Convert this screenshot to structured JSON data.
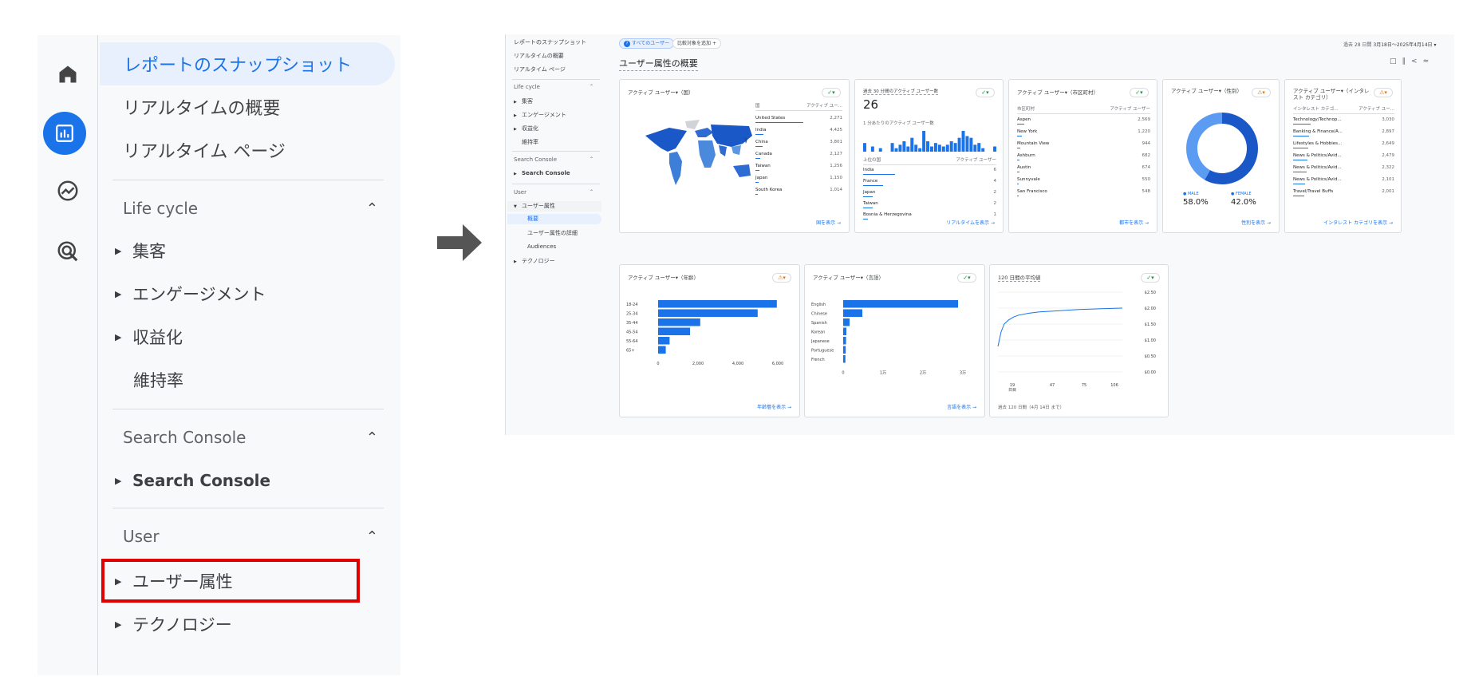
{
  "left_nav": {
    "items": {
      "snapshot": "レポートのスナップショット",
      "realtime_overview": "リアルタイムの概要",
      "realtime_pages": "リアルタイム ページ"
    },
    "sections": {
      "lifecycle": {
        "title": "Life cycle",
        "items": [
          "集客",
          "エンゲージメント",
          "収益化",
          "維持率"
        ]
      },
      "search_console": {
        "title": "Search Console",
        "items": [
          "Search Console"
        ]
      },
      "user": {
        "title": "User",
        "items": [
          "ユーザー属性",
          "テクノロジー"
        ]
      }
    }
  },
  "screenshot": {
    "nav": {
      "items": [
        "レポートのスナップショット",
        "リアルタイムの概要",
        "リアルタイム ページ"
      ],
      "lifecycle_title": "Life cycle",
      "lifecycle_items": [
        "集客",
        "エンゲージメント",
        "収益化",
        "維持率"
      ],
      "sc_title": "Search Console",
      "sc_item": "Search Console",
      "user_title": "User",
      "user_items": [
        "ユーザー属性",
        "概要",
        "ユーザー属性の詳細",
        "Audiences",
        "テクノロジー"
      ]
    },
    "header": {
      "chip_all_users": "すべてのユーザー",
      "chip_compare": "比較対象を追加",
      "page_title": "ユーザー属性の概要",
      "date_prefix": "過去 28 日間",
      "date_range": "3月18日～2025年4月14日"
    },
    "cards": {
      "country": {
        "title": "アクティブ ユーザー▾（国）",
        "col1": "国",
        "col2": "アクティブ ユー...",
        "rows": [
          {
            "name": "United States",
            "value": "2,271"
          },
          {
            "name": "India",
            "value": "4,425"
          },
          {
            "name": "China",
            "value": "3,801"
          },
          {
            "name": "Canada",
            "value": "2,127"
          },
          {
            "name": "Taiwan",
            "value": "1,256"
          },
          {
            "name": "Japan",
            "value": "1,150"
          },
          {
            "name": "South Korea",
            "value": "1,014"
          }
        ],
        "link": "国を表示 →"
      },
      "realtime": {
        "title": "過去 30 分間のアクティブ ユーザー数",
        "value": "26",
        "subtitle": "1 分あたりのアクティブ ユーザー数",
        "col1": "上位の国",
        "col2": "アクティブ ユーザー",
        "rows": [
          {
            "name": "India",
            "value": "6"
          },
          {
            "name": "France",
            "value": "4"
          },
          {
            "name": "Japan",
            "value": "2"
          },
          {
            "name": "Taiwan",
            "value": "2"
          },
          {
            "name": "Bosnia & Herzegovina",
            "value": "1"
          }
        ],
        "link": "リアルタイムを表示 →"
      },
      "city": {
        "title": "アクティブ ユーザー▾（市区町村）",
        "col1": "市区町村",
        "col2": "アクティブ ユーザー",
        "rows": [
          {
            "name": "Aspen",
            "value": "2,569"
          },
          {
            "name": "New York",
            "value": "1,220"
          },
          {
            "name": "Mountain View",
            "value": "944"
          },
          {
            "name": "Ashburn",
            "value": "682"
          },
          {
            "name": "Austin",
            "value": "674"
          },
          {
            "name": "Sunnyvale",
            "value": "550"
          },
          {
            "name": "San Francisco",
            "value": "548"
          }
        ],
        "link": "都市を表示 →"
      },
      "gender": {
        "title": "アクティブ ユーザー▾（性別）",
        "male_label": "● MALE",
        "female_label": "● FEMALE",
        "male_value": "58.0%",
        "female_value": "42.0%",
        "link": "性別を表示 →"
      },
      "interest": {
        "title": "アクティブ ユーザー▾（インタレスト カテゴリ）",
        "col1": "インタレスト カテゴ...",
        "col2": "アクティブ ユー...",
        "rows": [
          {
            "name": "Technology/Technop...",
            "value": "3,030"
          },
          {
            "name": "Banking & Finance/A...",
            "value": "2,897"
          },
          {
            "name": "Lifestyles & Hobbies...",
            "value": "2,649"
          },
          {
            "name": "News & Politics/Avid...",
            "value": "2,479"
          },
          {
            "name": "News & Politics/Avid...",
            "value": "2,322"
          },
          {
            "name": "News & Politics/Avid...",
            "value": "2,101"
          },
          {
            "name": "Travel/Travel Buffs",
            "value": "2,001"
          }
        ],
        "link": "インタレスト カテゴリを表示 →"
      },
      "age": {
        "title": "アクティブ ユーザー▾（年齢）",
        "link": "年齢層を表示 →"
      },
      "language": {
        "title": "アクティブ ユーザー▾（言語）",
        "link": "言語を表示 →"
      },
      "ltv": {
        "title": "120 日間の平均値",
        "footnote": "過去 120 日間（4月 14日 まで）"
      }
    }
  },
  "chart_data": [
    {
      "type": "bar",
      "orientation": "horizontal",
      "categories": [
        "18-24",
        "25-34",
        "35-44",
        "45-54",
        "55-64",
        "65+"
      ],
      "values": [
        4650,
        3900,
        1650,
        1250,
        450,
        300
      ],
      "xlim": [
        0,
        5000
      ],
      "xticks": [
        "0",
        "2,000",
        "4,000",
        "6,000"
      ]
    },
    {
      "type": "bar",
      "orientation": "horizontal",
      "categories": [
        "English",
        "Chinese",
        "Spanish",
        "Korean",
        "Japanese",
        "Portuguese",
        "French"
      ],
      "values": [
        36000,
        6000,
        2000,
        1000,
        900,
        800,
        700
      ],
      "xlim": [
        0,
        40000
      ],
      "xticks": [
        "0",
        "1万",
        "2万",
        "3万"
      ]
    },
    {
      "type": "line",
      "x": [
        0,
        3,
        6,
        10,
        15,
        20,
        30,
        40,
        50,
        60,
        70,
        80,
        90,
        100,
        110,
        120
      ],
      "values": [
        0.8,
        1.25,
        1.5,
        1.62,
        1.72,
        1.78,
        1.84,
        1.88,
        1.9,
        1.92,
        1.94,
        1.96,
        1.97,
        1.98,
        1.99,
        2.0
      ],
      "ylim": [
        0,
        2.5
      ],
      "yticks": [
        "$2.50",
        "$2.00",
        "$1.50",
        "$1.00",
        "$0.50",
        "$0.00"
      ],
      "xticks": [
        "19\n日目",
        "47",
        "75",
        "106"
      ]
    },
    {
      "type": "bar",
      "values": [
        5,
        0,
        3,
        0,
        2,
        0,
        0,
        5,
        2,
        4,
        6,
        3,
        8,
        4,
        2,
        12,
        6,
        3,
        5,
        4,
        3,
        4,
        6,
        5,
        8,
        12,
        9,
        8,
        4,
        5,
        2,
        0,
        0,
        3
      ]
    },
    {
      "type": "pie",
      "categories": [
        "MALE",
        "FEMALE"
      ],
      "values": [
        58.0,
        42.0
      ]
    }
  ]
}
